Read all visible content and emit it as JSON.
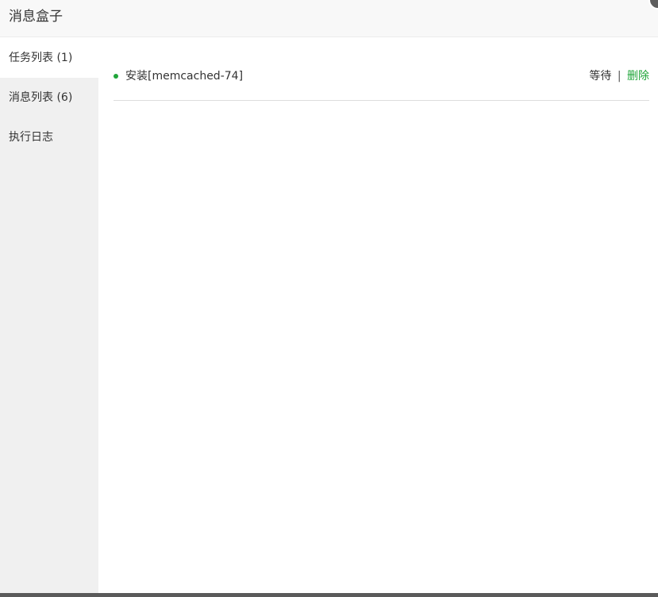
{
  "dialog": {
    "title": "消息盒子",
    "close_icon": "close-icon"
  },
  "sidebar": {
    "items": [
      {
        "label": "任务列表 (1)",
        "active": true
      },
      {
        "label": "消息列表 (6)",
        "active": false
      },
      {
        "label": "执行日志",
        "active": false
      }
    ]
  },
  "tasks": [
    {
      "name": "安装[memcached-74]",
      "status": "等待",
      "separator": "|",
      "delete_label": "删除",
      "status_dot_color": "#20a53a"
    }
  ],
  "colors": {
    "accent": "#20a53a",
    "sidebar_bg": "#f0f0f0",
    "titlebar_bg": "#f8f8f8"
  }
}
